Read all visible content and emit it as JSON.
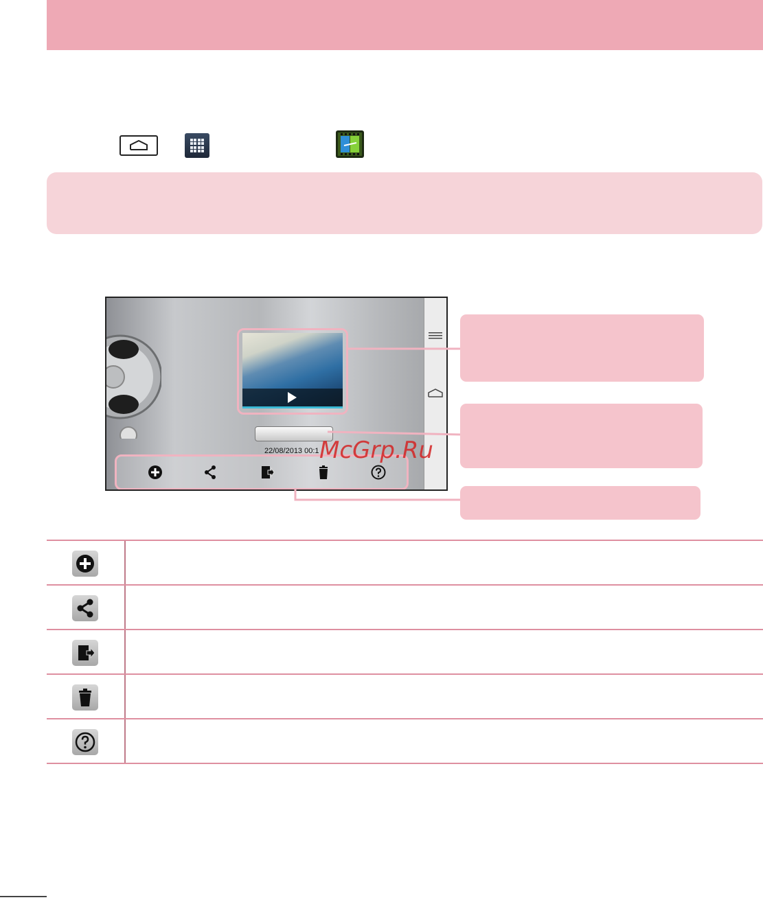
{
  "phone_screen": {
    "date_time": "22/08/2013  00:1"
  },
  "watermark": "McGrp.Ru",
  "colors": {
    "header": "#eea9b5",
    "note_bg": "#f6d4d9",
    "callout_bg": "#f5c4cc",
    "table_rule": "#de8fa0",
    "highlight": "#f0b3c0",
    "watermark": "#d42424"
  },
  "icons": {
    "instruction_row": [
      "home-key-icon",
      "apps-icon",
      "video-editor-app-icon"
    ],
    "phone_nav": [
      "menu-icon",
      "home-icon"
    ],
    "toolbar": [
      "add-icon",
      "share-icon",
      "export-icon",
      "delete-icon",
      "help-icon"
    ],
    "table_rows": [
      "add-icon",
      "share-icon",
      "export-icon",
      "delete-icon",
      "help-icon"
    ]
  }
}
